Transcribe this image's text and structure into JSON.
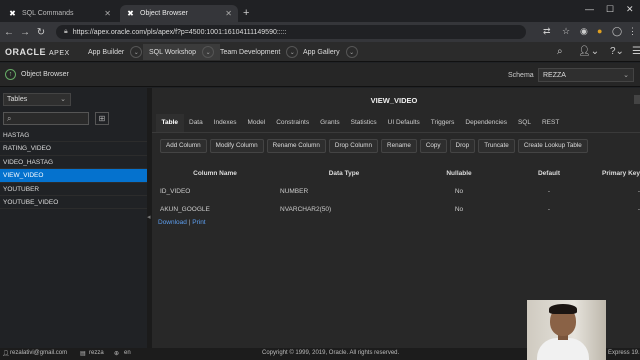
{
  "browser": {
    "tabs": [
      {
        "label": "SQL Commands",
        "active": false
      },
      {
        "label": "Object Browser",
        "active": true
      }
    ],
    "url": "https://apex.oracle.com/pls/apex/f?p=4500:1001:16104111149590:::::"
  },
  "apex": {
    "logo_main": "ORACLE",
    "logo_sub": "APEX",
    "menu": [
      {
        "label": "App Builder",
        "active": false
      },
      {
        "label": "SQL Workshop",
        "active": true
      },
      {
        "label": "Team Development",
        "active": false
      },
      {
        "label": "App Gallery",
        "active": false
      }
    ]
  },
  "subheader": {
    "title": "Object Browser",
    "schema_label": "Schema",
    "schema_value": "REZZA"
  },
  "left": {
    "object_type": "Tables",
    "tables": [
      "HASTAG",
      "RATING_VIDEO",
      "VIDEO_HASTAG",
      "VIEW_VIDEO",
      "YOUTUBER",
      "YOUTUBE_VIDEO"
    ],
    "selected": "VIEW_VIDEO"
  },
  "main": {
    "title": "VIEW_VIDEO",
    "tabs": [
      "Table",
      "Data",
      "Indexes",
      "Model",
      "Constraints",
      "Grants",
      "Statistics",
      "UI Defaults",
      "Triggers",
      "Dependencies",
      "SQL",
      "REST"
    ],
    "active_tab": "Table",
    "actions": [
      "Add Column",
      "Modify Column",
      "Rename Column",
      "Drop Column",
      "Rename",
      "Copy",
      "Drop",
      "Truncate",
      "Create Lookup Table"
    ],
    "columns": [
      "Column Name",
      "Data Type",
      "Nullable",
      "Default",
      "Primary Key"
    ],
    "rows": [
      {
        "name": "ID_VIDEO",
        "type": "NUMBER",
        "nullable": "No",
        "default": "-",
        "pk": "-"
      },
      {
        "name": "AKUN_GOOGLE",
        "type": "NVARCHAR2(50)",
        "nullable": "No",
        "default": "-",
        "pk": "-"
      }
    ],
    "download": "Download",
    "print": "Print"
  },
  "footer": {
    "email": "rezalativi@gmail.com",
    "workspace": "rezza",
    "language": "en",
    "copyright": "Copyright © 1999, 2019, Oracle. All rights reserved.",
    "version": "Express 19."
  }
}
